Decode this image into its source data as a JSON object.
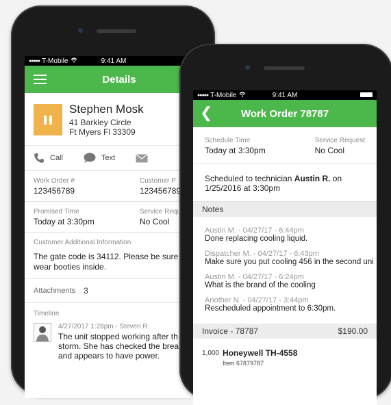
{
  "status_bar_back": {
    "carrier": "T-Mobile",
    "time": "9:41 AM"
  },
  "status_bar_front": {
    "carrier": "T-Mobile",
    "time": "9:41 AM"
  },
  "details": {
    "title": "Details",
    "customer": {
      "name": "Stephen Mosk",
      "address1": "41 Barkley Circle",
      "address2": "Ft Myers Fl 33309"
    },
    "actions": {
      "call": "Call",
      "text": "Text"
    },
    "work_order_label": "Work Order #",
    "work_order_value": "123456789",
    "customer_po_label": "Customer P",
    "customer_po_value": "123456789",
    "promised_label": "Promised Time",
    "promised_value": "Today at 3:30pm",
    "service_label": "Service Requ",
    "service_value": "No Cool",
    "additional_label": "Customer Additional Information",
    "additional_line1": "The gate code is 34112. Please be sure",
    "additional_line2": "wear booties inside.",
    "attachments_label": "Attachments",
    "attachments_count": "3",
    "timeline_label": "Timeline",
    "timeline_entry": {
      "meta": "4/27/2017 1:28pm - Steven R.",
      "line1": "The unit stopped working after th",
      "line2": "storm. She has checked the brea",
      "line3": "and appears to have power."
    }
  },
  "work_order": {
    "title": "Work Order 78787",
    "schedule_label": "Schedule Time",
    "schedule_value": "Today at 3:30pm",
    "service_label": "Service Request",
    "service_value": "No Cool",
    "scheduled_prefix": "Scheduled to technician",
    "technician": "Austin R.",
    "scheduled_on": "on",
    "scheduled_date": "1/25/2016 at 3:30pm",
    "notes_label": "Notes",
    "notes": [
      {
        "meta": "Austin M. - 04/27/17 - 6:44pm",
        "text": "Done replacing cooling liquid."
      },
      {
        "meta": "Dispatcher M. - 04/27/17 - 6:43pm",
        "text": "Make sure you put cooling 456 in the second uni"
      },
      {
        "meta": "Austin M. - 04/27/17 - 6:24pm",
        "text": "What is the brand of the cooling"
      },
      {
        "meta": "Another N. - 04/27/17 - 3:44pm",
        "text": "Rescheduled appointment to 6:30pm."
      }
    ],
    "invoice_label": "Invoice - 78787",
    "invoice_total": "$190.00",
    "invoice_item": {
      "qty": "1,000",
      "name": "Honeywell TH-4558",
      "sub": "Item 67879787"
    }
  },
  "colors": {
    "accent": "#4cb74a",
    "pause": "#f0b24a"
  }
}
